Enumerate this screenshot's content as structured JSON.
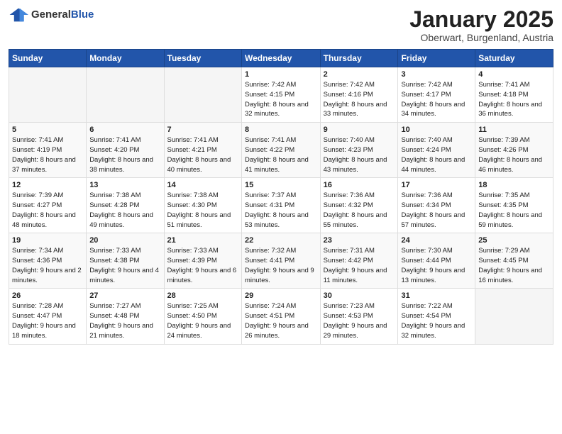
{
  "header": {
    "logo_general": "General",
    "logo_blue": "Blue",
    "main_title": "January 2025",
    "subtitle": "Oberwart, Burgenland, Austria"
  },
  "days_of_week": [
    "Sunday",
    "Monday",
    "Tuesday",
    "Wednesday",
    "Thursday",
    "Friday",
    "Saturday"
  ],
  "weeks": [
    [
      {
        "day": "",
        "info": ""
      },
      {
        "day": "",
        "info": ""
      },
      {
        "day": "",
        "info": ""
      },
      {
        "day": "1",
        "info": "Sunrise: 7:42 AM\nSunset: 4:15 PM\nDaylight: 8 hours and 32 minutes."
      },
      {
        "day": "2",
        "info": "Sunrise: 7:42 AM\nSunset: 4:16 PM\nDaylight: 8 hours and 33 minutes."
      },
      {
        "day": "3",
        "info": "Sunrise: 7:42 AM\nSunset: 4:17 PM\nDaylight: 8 hours and 34 minutes."
      },
      {
        "day": "4",
        "info": "Sunrise: 7:41 AM\nSunset: 4:18 PM\nDaylight: 8 hours and 36 minutes."
      }
    ],
    [
      {
        "day": "5",
        "info": "Sunrise: 7:41 AM\nSunset: 4:19 PM\nDaylight: 8 hours and 37 minutes."
      },
      {
        "day": "6",
        "info": "Sunrise: 7:41 AM\nSunset: 4:20 PM\nDaylight: 8 hours and 38 minutes."
      },
      {
        "day": "7",
        "info": "Sunrise: 7:41 AM\nSunset: 4:21 PM\nDaylight: 8 hours and 40 minutes."
      },
      {
        "day": "8",
        "info": "Sunrise: 7:41 AM\nSunset: 4:22 PM\nDaylight: 8 hours and 41 minutes."
      },
      {
        "day": "9",
        "info": "Sunrise: 7:40 AM\nSunset: 4:23 PM\nDaylight: 8 hours and 43 minutes."
      },
      {
        "day": "10",
        "info": "Sunrise: 7:40 AM\nSunset: 4:24 PM\nDaylight: 8 hours and 44 minutes."
      },
      {
        "day": "11",
        "info": "Sunrise: 7:39 AM\nSunset: 4:26 PM\nDaylight: 8 hours and 46 minutes."
      }
    ],
    [
      {
        "day": "12",
        "info": "Sunrise: 7:39 AM\nSunset: 4:27 PM\nDaylight: 8 hours and 48 minutes."
      },
      {
        "day": "13",
        "info": "Sunrise: 7:38 AM\nSunset: 4:28 PM\nDaylight: 8 hours and 49 minutes."
      },
      {
        "day": "14",
        "info": "Sunrise: 7:38 AM\nSunset: 4:30 PM\nDaylight: 8 hours and 51 minutes."
      },
      {
        "day": "15",
        "info": "Sunrise: 7:37 AM\nSunset: 4:31 PM\nDaylight: 8 hours and 53 minutes."
      },
      {
        "day": "16",
        "info": "Sunrise: 7:36 AM\nSunset: 4:32 PM\nDaylight: 8 hours and 55 minutes."
      },
      {
        "day": "17",
        "info": "Sunrise: 7:36 AM\nSunset: 4:34 PM\nDaylight: 8 hours and 57 minutes."
      },
      {
        "day": "18",
        "info": "Sunrise: 7:35 AM\nSunset: 4:35 PM\nDaylight: 8 hours and 59 minutes."
      }
    ],
    [
      {
        "day": "19",
        "info": "Sunrise: 7:34 AM\nSunset: 4:36 PM\nDaylight: 9 hours and 2 minutes."
      },
      {
        "day": "20",
        "info": "Sunrise: 7:33 AM\nSunset: 4:38 PM\nDaylight: 9 hours and 4 minutes."
      },
      {
        "day": "21",
        "info": "Sunrise: 7:33 AM\nSunset: 4:39 PM\nDaylight: 9 hours and 6 minutes."
      },
      {
        "day": "22",
        "info": "Sunrise: 7:32 AM\nSunset: 4:41 PM\nDaylight: 9 hours and 9 minutes."
      },
      {
        "day": "23",
        "info": "Sunrise: 7:31 AM\nSunset: 4:42 PM\nDaylight: 9 hours and 11 minutes."
      },
      {
        "day": "24",
        "info": "Sunrise: 7:30 AM\nSunset: 4:44 PM\nDaylight: 9 hours and 13 minutes."
      },
      {
        "day": "25",
        "info": "Sunrise: 7:29 AM\nSunset: 4:45 PM\nDaylight: 9 hours and 16 minutes."
      }
    ],
    [
      {
        "day": "26",
        "info": "Sunrise: 7:28 AM\nSunset: 4:47 PM\nDaylight: 9 hours and 18 minutes."
      },
      {
        "day": "27",
        "info": "Sunrise: 7:27 AM\nSunset: 4:48 PM\nDaylight: 9 hours and 21 minutes."
      },
      {
        "day": "28",
        "info": "Sunrise: 7:25 AM\nSunset: 4:50 PM\nDaylight: 9 hours and 24 minutes."
      },
      {
        "day": "29",
        "info": "Sunrise: 7:24 AM\nSunset: 4:51 PM\nDaylight: 9 hours and 26 minutes."
      },
      {
        "day": "30",
        "info": "Sunrise: 7:23 AM\nSunset: 4:53 PM\nDaylight: 9 hours and 29 minutes."
      },
      {
        "day": "31",
        "info": "Sunrise: 7:22 AM\nSunset: 4:54 PM\nDaylight: 9 hours and 32 minutes."
      },
      {
        "day": "",
        "info": ""
      }
    ]
  ]
}
